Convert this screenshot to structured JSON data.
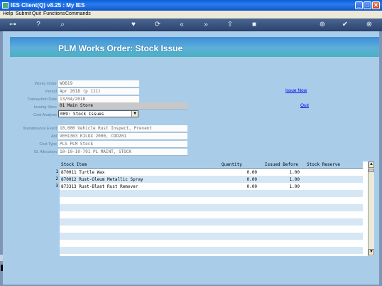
{
  "window": {
    "title": "IES Client(Q) v8.25 : My IES",
    "controls": [
      "_",
      "□",
      "✕"
    ]
  },
  "menu": [
    "Help",
    "Submit",
    "Quit",
    "Functions",
    "Commands"
  ],
  "toolbar": {
    "icons": [
      "key-icon",
      "help-icon",
      "search-icon",
      "heart-icon",
      "refresh-icon",
      "rewind-icon",
      "fast-forward-icon",
      "upload-icon",
      "stop-icon",
      "add-icon",
      "check-icon",
      "close-icon"
    ]
  },
  "page": {
    "title": "PLM Works Order: Stock Issue"
  },
  "form": {
    "works_order": {
      "label": "Works Order",
      "value": "WO619"
    },
    "period": {
      "label": "Period",
      "value": "Apr 2018 (p 111)"
    },
    "transaction_date": {
      "label": "Transaction Date",
      "value": "13/04/2018"
    },
    "issuing_store": {
      "label": "Issuing Store",
      "value": "01 Main Store"
    },
    "cost_analysis": {
      "label": "Cost Analysis",
      "value": "009: Stock Issues"
    },
    "maintenance_event": {
      "label": "Maintenance Event",
      "value": "10,000 Vehicle Rust Inspect, Prevent"
    },
    "asset": {
      "label": "Ahl",
      "value": "VEH1363 KILUX 2000, CDD201"
    },
    "cost_type": {
      "label": "Cost Type",
      "value": "PLS PLM Stock"
    },
    "gl_allocation": {
      "label": "GL Allocation",
      "value": "10-10-10-791 PL MAINT, STOCK"
    }
  },
  "actions": {
    "issue_now": "Issue Now",
    "quit": "Quit"
  },
  "table": {
    "columns": [
      "Stock Item",
      "Quantity",
      "Issued Before",
      "Stock Reserve"
    ],
    "rows": [
      {
        "num": "1",
        "item": "870011 Turtle Wax",
        "quantity": "0.00",
        "issued_before": "1.00",
        "stock_reserve": ""
      },
      {
        "num": "2",
        "item": "870012 Rust-Oleum Metallic Spray",
        "quantity": "0.00",
        "issued_before": "1.00",
        "stock_reserve": ""
      },
      {
        "num": "3",
        "item": "873313 Rust-Blast Rust Remover",
        "quantity": "0.00",
        "issued_before": "1.00",
        "stock_reserve": ""
      }
    ]
  },
  "colors": {
    "content_bg": "#a9cde9",
    "header_band": "#5cb0d8",
    "title_bar": "#0a5fd8",
    "link": "#0000ee"
  }
}
